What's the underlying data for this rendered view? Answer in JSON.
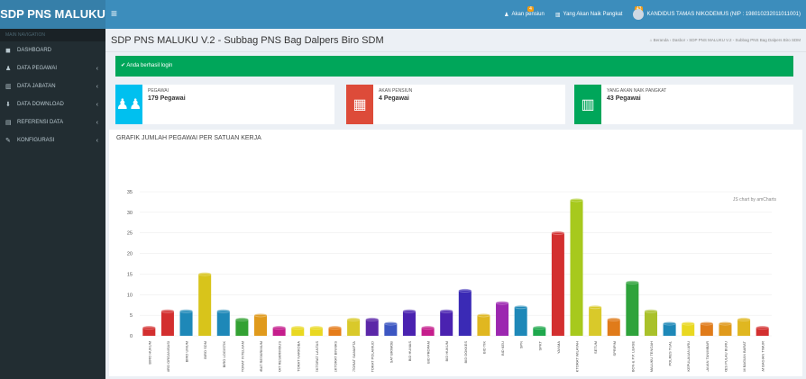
{
  "app": {
    "logo": "SDP PNS MALUKU",
    "menu_icon": "≡"
  },
  "topbar": {
    "pensiun": {
      "label": "Akan pensiun",
      "badge": "4"
    },
    "naik": {
      "label": "Yang Akan Naik Pangkat",
      "badge": "43"
    },
    "user": {
      "label": "KANDIDUS TAMAS NIKODEMUS (NIP : 198010232011011001)"
    }
  },
  "sidebar": {
    "header": "MAIN NAVIGATION",
    "items": [
      {
        "label": "DASHBOARD",
        "icon": "dashboard-icon",
        "glyph": "◼",
        "has_children": false
      },
      {
        "label": "DATA PEGAWAI",
        "icon": "users-icon",
        "glyph": "♟",
        "has_children": true
      },
      {
        "label": "DATA JABATAN",
        "icon": "bar-chart-icon",
        "glyph": "▥",
        "has_children": true
      },
      {
        "label": "DATA DOWNLOAD",
        "icon": "download-icon",
        "glyph": "⬇",
        "has_children": true
      },
      {
        "label": "REFERENSI DATA",
        "icon": "table-icon",
        "glyph": "▤",
        "has_children": true
      },
      {
        "label": "KONFIGURASI",
        "icon": "wrench-icon",
        "glyph": "✎",
        "has_children": true
      }
    ]
  },
  "header": {
    "title": "SDP PNS MALUKU V.2 - Subbag PNS Bag Dalpers Biro SDM",
    "breadcrumb": [
      "Beranda",
      "Dasbor",
      "SDP PNS MALUKU V.2 - Subbag PNS Bag Dalpers Biro SDM"
    ]
  },
  "alert": {
    "text": "✔ Anda berhasil login"
  },
  "info": [
    {
      "label": "PEGAWAI",
      "value": "179 Pegawai",
      "color": "#00c0ef",
      "icon": "users-icon",
      "glyph": "♟♟"
    },
    {
      "label": "AKAN PENSIUN",
      "value": "4 Pegawai",
      "color": "#dd4b39",
      "icon": "calendar-icon",
      "glyph": "▦"
    },
    {
      "label": "YANG AKAN NAIK PANGKAT",
      "value": "43 Pegawai",
      "color": "#00a65a",
      "icon": "bar-chart-icon",
      "glyph": "▥"
    }
  ],
  "chart_title": "GRAFIK JUMLAH PEGAWAI PER SATUAN KERJA",
  "chart_credit": "JS chart by amCharts",
  "chart_data": {
    "type": "bar",
    "ylim": [
      0,
      35
    ],
    "yticks": [
      0,
      5,
      10,
      15,
      20,
      25,
      30,
      35
    ],
    "categories": [
      "BIRO HUKUM",
      "BIRO ORGANISASI",
      "BIRO UMUM",
      "BIRO SDM",
      "BIRO LOGISTIK",
      "DIREKTORAT INTELKAM",
      "DIREKTORAT RESKRIMUM",
      "DIREKTORAT RESKRIMSUS",
      "DIREKTORAT NARKOBA",
      "DIREKTORAT LANTAS",
      "DIREKTORAT BINMAS",
      "DIREKTORAT SAMAPTA",
      "DIREKTORAT POLAIRUD",
      "SAT BRIMOB",
      "BID HUMAS",
      "BID PROPAM",
      "BID HUKUM",
      "BID DOKKES",
      "BID TIK",
      "BID KEU",
      "SPN",
      "SPKT",
      "YANMA",
      "INSPEKTORAT WILAYAH",
      "SETUM",
      "SPRIPIM",
      "POLRES AMBON & P.P. LEASE",
      "POLRES MALUKU TENGAH",
      "POLRES TUAL",
      "POLRES KEPULAUAN ARU",
      "POLRES KEPULAUAN TANIMBAR",
      "POLRES PULAU BURU",
      "POLRES SERAM BAGIAN BARAT",
      "POLRES SERAM BAGIAN TIMUR"
    ],
    "values": [
      2,
      6,
      6,
      15,
      6,
      4,
      5,
      2,
      2,
      2,
      2,
      4,
      4,
      3,
      6,
      2,
      6,
      11,
      5,
      8,
      7,
      2,
      25,
      33,
      7,
      4,
      13,
      6,
      3,
      3,
      3,
      3,
      4,
      2
    ],
    "colors": [
      "#d32f2f",
      "#d32f2f",
      "#1e88b8",
      "#d8c41b",
      "#1e88b8",
      "#33a133",
      "#e09a1c",
      "#c51d8c",
      "#e9d821",
      "#e9d821",
      "#e57c1a",
      "#d9c92a",
      "#5b27a8",
      "#3c56c2",
      "#4a22b0",
      "#c51d8c",
      "#4a22b0",
      "#3a2ab5",
      "#e0b720",
      "#9c27b0",
      "#1e88b8",
      "#1fa84d",
      "#d32f2f",
      "#a7c91d",
      "#d9c92a",
      "#e07b1a",
      "#2ea33b",
      "#a9c12a",
      "#1e88b8",
      "#e9d821",
      "#e07b1a",
      "#e09a1c",
      "#e0b720",
      "#d32f2f"
    ]
  }
}
